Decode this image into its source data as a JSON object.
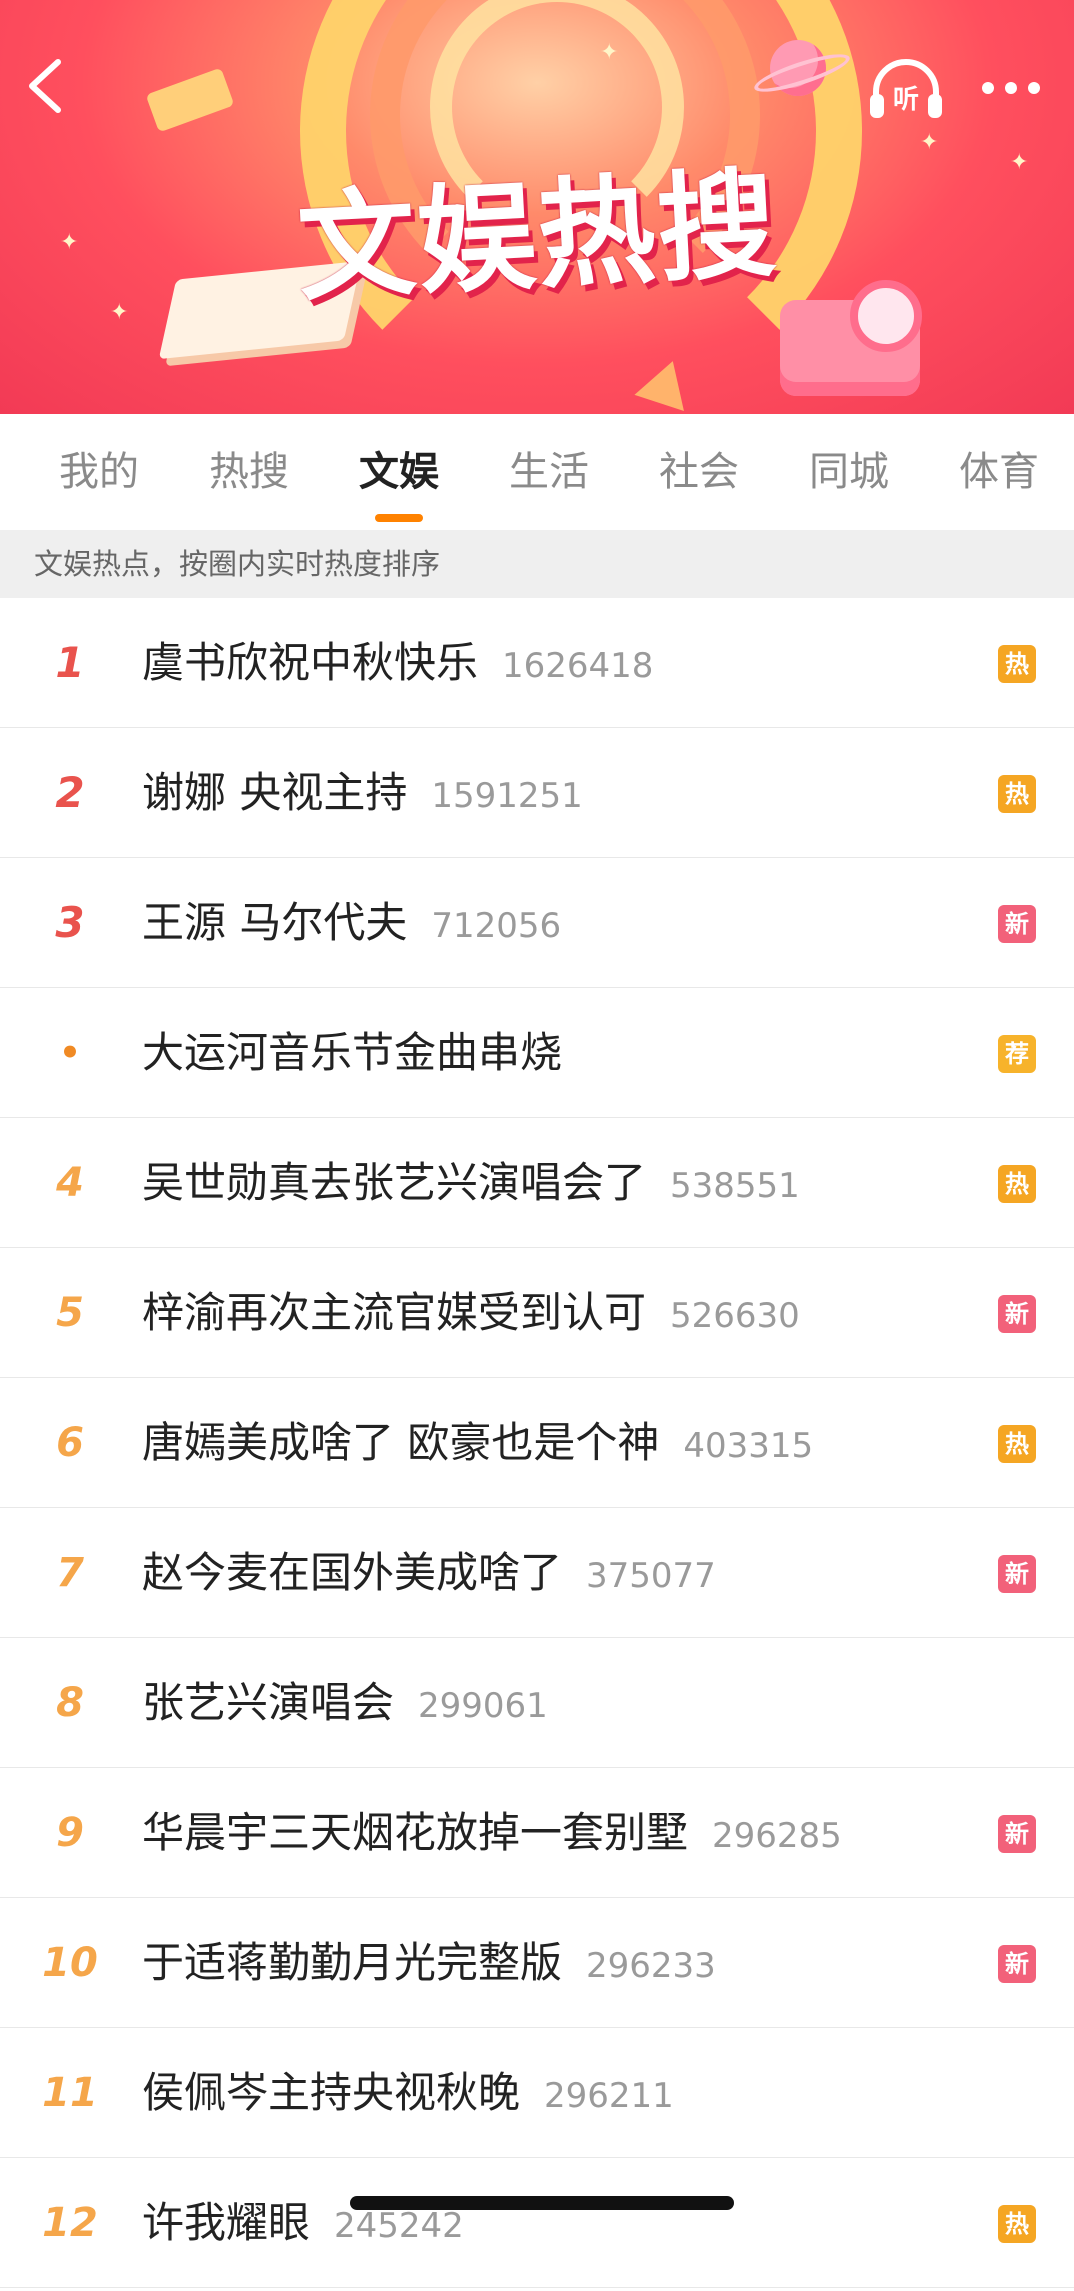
{
  "banner": {
    "title": "文娱热搜",
    "listen_label": "听"
  },
  "tabs": [
    {
      "label": "我的",
      "active": false
    },
    {
      "label": "热搜",
      "active": false
    },
    {
      "label": "文娱",
      "active": true
    },
    {
      "label": "生活",
      "active": false
    },
    {
      "label": "社会",
      "active": false
    },
    {
      "label": "同城",
      "active": false
    },
    {
      "label": "体育",
      "active": false
    }
  ],
  "subtitle": "文娱热点，按圈内实时热度排序",
  "badge_colors": {
    "热": "#f5a623",
    "新": "#f2617a",
    "荐": "#f7b32b"
  },
  "items": [
    {
      "rank": "1",
      "title": "虞书欣祝中秋快乐",
      "heat": "1626418",
      "badge": "热"
    },
    {
      "rank": "2",
      "title": "谢娜 央视主持",
      "heat": "1591251",
      "badge": "热"
    },
    {
      "rank": "3",
      "title": "王源 马尔代夫",
      "heat": "712056",
      "badge": "新"
    },
    {
      "rank": "•",
      "title": "大运河音乐节金曲串烧",
      "heat": "",
      "badge": "荐"
    },
    {
      "rank": "4",
      "title": "吴世勋真去张艺兴演唱会了",
      "heat": "538551",
      "badge": "热"
    },
    {
      "rank": "5",
      "title": "梓渝再次主流官媒受到认可",
      "heat": "526630",
      "badge": "新"
    },
    {
      "rank": "6",
      "title": "唐嫣美成啥了 欧豪也是个神",
      "heat": "403315",
      "badge": "热"
    },
    {
      "rank": "7",
      "title": "赵今麦在国外美成啥了",
      "heat": "375077",
      "badge": "新"
    },
    {
      "rank": "8",
      "title": "张艺兴演唱会",
      "heat": "299061",
      "badge": ""
    },
    {
      "rank": "9",
      "title": "华晨宇三天烟花放掉一套别墅",
      "heat": "296285",
      "badge": "新"
    },
    {
      "rank": "10",
      "title": "于适蒋勤勤月光完整版",
      "heat": "296233",
      "badge": "新"
    },
    {
      "rank": "11",
      "title": "侯佩岑主持央视秋晚",
      "heat": "296211",
      "badge": ""
    },
    {
      "rank": "12",
      "title": "许我耀眼",
      "heat": "245242",
      "badge": "热"
    }
  ]
}
